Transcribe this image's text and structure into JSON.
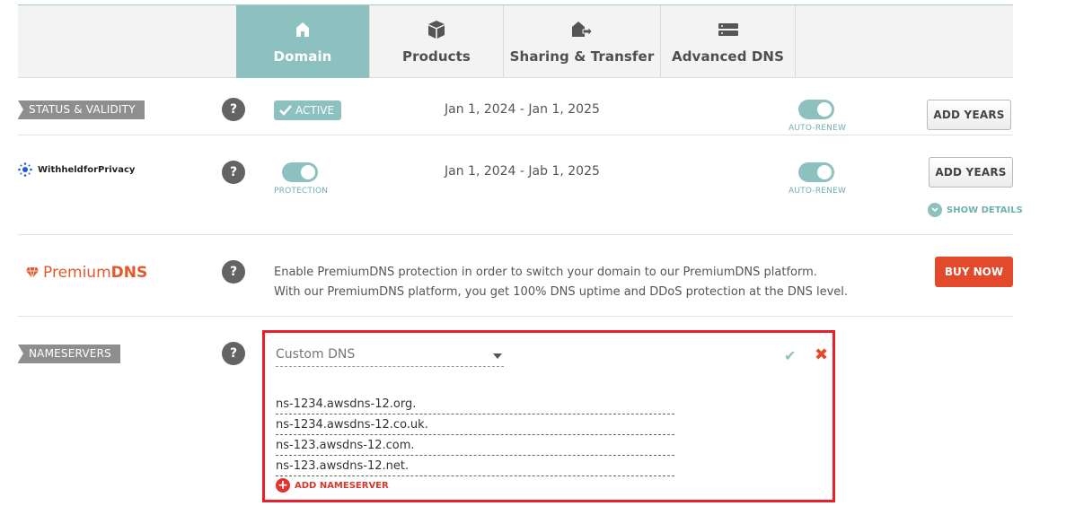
{
  "tabs": [
    {
      "label": "Domain",
      "icon": "home-icon",
      "active": true
    },
    {
      "label": "Products",
      "icon": "box-icon",
      "active": false
    },
    {
      "label": "Sharing & Transfer",
      "icon": "transfer-icon",
      "active": false
    },
    {
      "label": "Advanced DNS",
      "icon": "server-icon",
      "active": false
    }
  ],
  "status": {
    "tag": "STATUS & VALIDITY",
    "badge": "ACTIVE",
    "dates": "Jan 1, 2024 - Jan 1, 2025",
    "autorenew_label": "AUTO-RENEW",
    "add_years": "ADD YEARS"
  },
  "privacy": {
    "logo_text": "WithheldforPrivacy",
    "protection_label": "PROTECTION",
    "dates": "Jan 1, 2024 - Jab 1, 2025",
    "autorenew_label": "AUTO-RENEW",
    "add_years": "ADD YEARS",
    "show_details": "SHOW DETAILS"
  },
  "premium": {
    "logo_prefix": "Premium",
    "logo_suffix": "DNS",
    "line1": "Enable PremiumDNS protection in order to switch your domain to our PremiumDNS platform.",
    "line2": "With our PremiumDNS platform, you get 100% DNS uptime and DDoS protection at the DNS level.",
    "buy_now": "BUY NOW"
  },
  "nameservers": {
    "tag": "NAMESERVERS",
    "selected": "Custom DNS",
    "items": [
      "ns-1234.awsdns-12.org.",
      "ns-1234.awsdns-12.co.uk.",
      "ns-123.awsdns-12.com.",
      "ns-123.awsdns-12.net."
    ],
    "add_label": "ADD NAMESERVER"
  },
  "help_glyph": "?",
  "colors": {
    "accent": "#8cc1bf",
    "danger": "#e24a2b",
    "highlight_border": "#e8202c"
  }
}
